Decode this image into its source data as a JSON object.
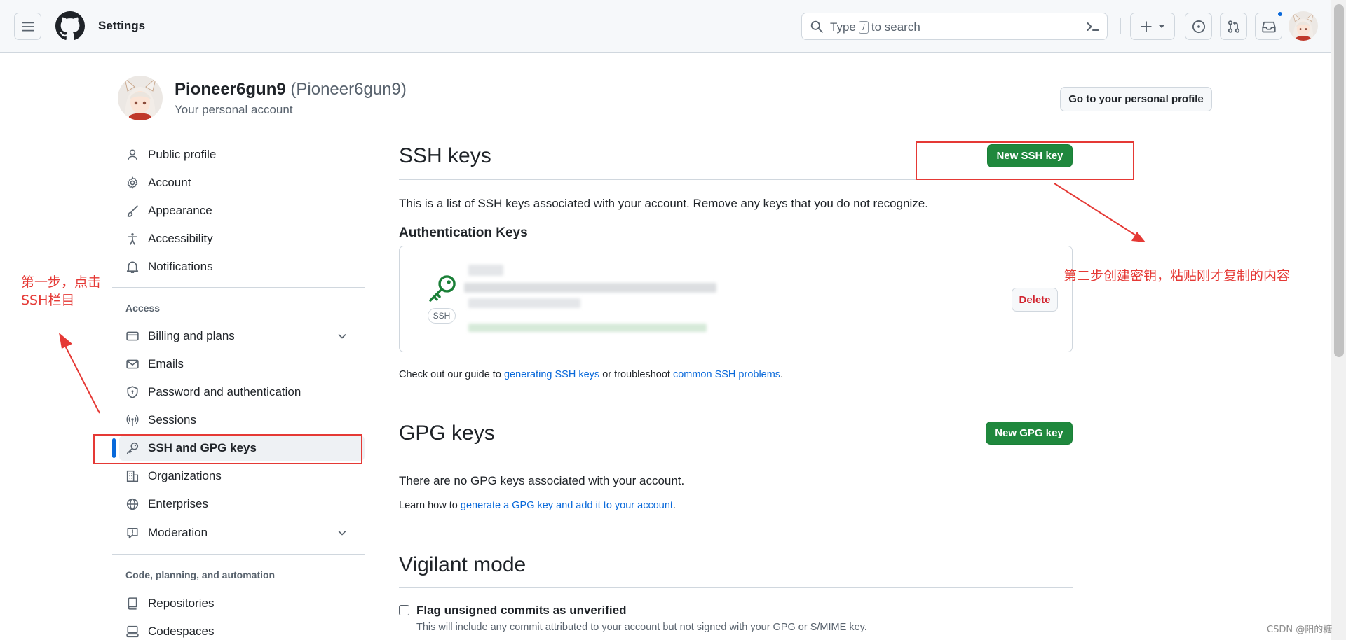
{
  "header": {
    "title": "Settings",
    "search_placeholder_before": "Type",
    "search_kbd": "/",
    "search_placeholder_after": "to search"
  },
  "profile": {
    "name": "Pioneer6gun9",
    "login": "(Pioneer6gun9)",
    "subtitle": "Your personal account",
    "go_profile_label": "Go to your personal profile"
  },
  "sidebar": {
    "items_top": [
      {
        "label": "Public profile",
        "icon": "person-icon"
      },
      {
        "label": "Account",
        "icon": "gear-icon"
      },
      {
        "label": "Appearance",
        "icon": "paintbrush-icon"
      },
      {
        "label": "Accessibility",
        "icon": "accessibility-icon"
      },
      {
        "label": "Notifications",
        "icon": "bell-icon"
      }
    ],
    "access_heading": "Access",
    "items_access": [
      {
        "label": "Billing and plans",
        "icon": "credit-card-icon",
        "expandable": true
      },
      {
        "label": "Emails",
        "icon": "mail-icon"
      },
      {
        "label": "Password and authentication",
        "icon": "shield-lock-icon"
      },
      {
        "label": "Sessions",
        "icon": "broadcast-icon"
      },
      {
        "label": "SSH and GPG keys",
        "icon": "key-icon",
        "active": true
      },
      {
        "label": "Organizations",
        "icon": "organization-icon"
      },
      {
        "label": "Enterprises",
        "icon": "globe-icon"
      },
      {
        "label": "Moderation",
        "icon": "report-icon",
        "expandable": true
      }
    ],
    "code_heading": "Code, planning, and automation",
    "items_code": [
      {
        "label": "Repositories",
        "icon": "repo-icon"
      },
      {
        "label": "Codespaces",
        "icon": "codespaces-icon"
      }
    ]
  },
  "ssh": {
    "title": "SSH keys",
    "new_button": "New SSH key",
    "description": "This is a list of SSH keys associated with your account. Remove any keys that you do not recognize.",
    "auth_heading": "Authentication Keys",
    "key_type_label": "SSH",
    "delete_button": "Delete",
    "guide_prefix": "Check out our guide to",
    "guide_link1": "generating SSH keys",
    "guide_middle": "or troubleshoot",
    "guide_link2": "common SSH problems",
    "guide_suffix": "."
  },
  "gpg": {
    "title": "GPG keys",
    "new_button": "New GPG key",
    "empty_text": "There are no GPG keys associated with your account.",
    "learn_prefix": "Learn how to",
    "learn_link": "generate a GPG key and add it to your account",
    "learn_suffix": "."
  },
  "vigilant": {
    "title": "Vigilant mode",
    "checkbox_label": "Flag unsigned commits as unverified",
    "checkbox_desc": "This will include any commit attributed to your account but not signed with your GPG or S/MIME key.",
    "checked": false
  },
  "annotations": {
    "step1_line1": "第一步，点击",
    "step1_line2": "SSH栏目",
    "step2": "第二步创建密钥，粘贴刚才复制的内容"
  },
  "watermark": "CSDN @阳的糖",
  "colors": {
    "primary_green": "#1f883d",
    "link_blue": "#0969da",
    "annotation_red": "#e53935",
    "danger_red": "#d1242f"
  }
}
